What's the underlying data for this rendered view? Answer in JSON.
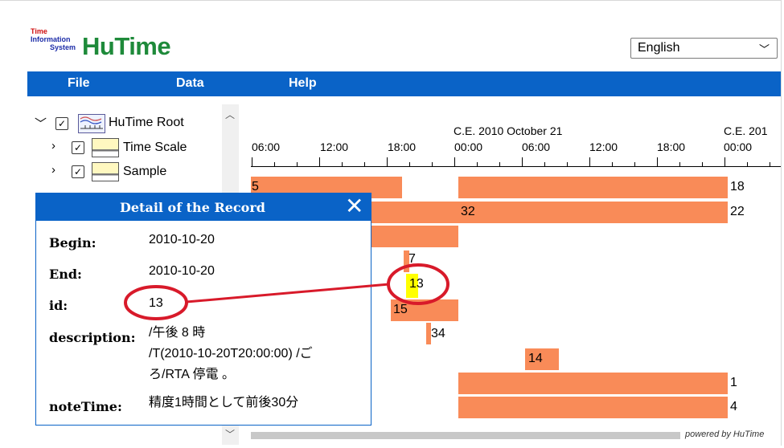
{
  "logo": {
    "line1": "Time",
    "line2": "Information",
    "line3": "System",
    "brand": "HuTime"
  },
  "language_select": {
    "value": "English"
  },
  "menu": [
    {
      "label": "File"
    },
    {
      "label": "Data"
    },
    {
      "label": "Help"
    }
  ],
  "tree": {
    "root": {
      "label": "HuTime Root",
      "checked": true
    },
    "items": [
      {
        "label": "Time Scale",
        "checked": true
      },
      {
        "label": "Sample",
        "checked": true
      }
    ]
  },
  "timeline": {
    "date_labels": [
      "C.E. 2010 October 21",
      "C.E. 201"
    ],
    "time_labels": [
      "06:00",
      "12:00",
      "18:00",
      "00:00",
      "06:00",
      "12:00",
      "18:00",
      "00:00"
    ],
    "bar_labels": [
      "5",
      "18",
      "32",
      "22",
      "7",
      "13",
      "15",
      "34",
      "14",
      "1",
      "4"
    ]
  },
  "dialog": {
    "title": "Detail of the Record",
    "fields": [
      {
        "label": "Begin:",
        "value": "2010-10-20"
      },
      {
        "label": "End:",
        "value": "2010-10-20"
      },
      {
        "label": "id:",
        "value": "13"
      },
      {
        "label": "description:",
        "value_lines": [
          "/午後 8 時",
          "/T(2010-10-20T20:00:00) /ご",
          "ろ/RTA 停電 。"
        ]
      },
      {
        "label": "noteTime:",
        "value": "精度1時間として前後30分"
      }
    ]
  },
  "footer": {
    "powered": "powered by HuTime"
  },
  "colors": {
    "menubar": "#0a63c7",
    "bar": "#f98b58",
    "brand": "#1e8a3a",
    "annotation": "#d81a2a",
    "highlight": "#ffff00"
  }
}
